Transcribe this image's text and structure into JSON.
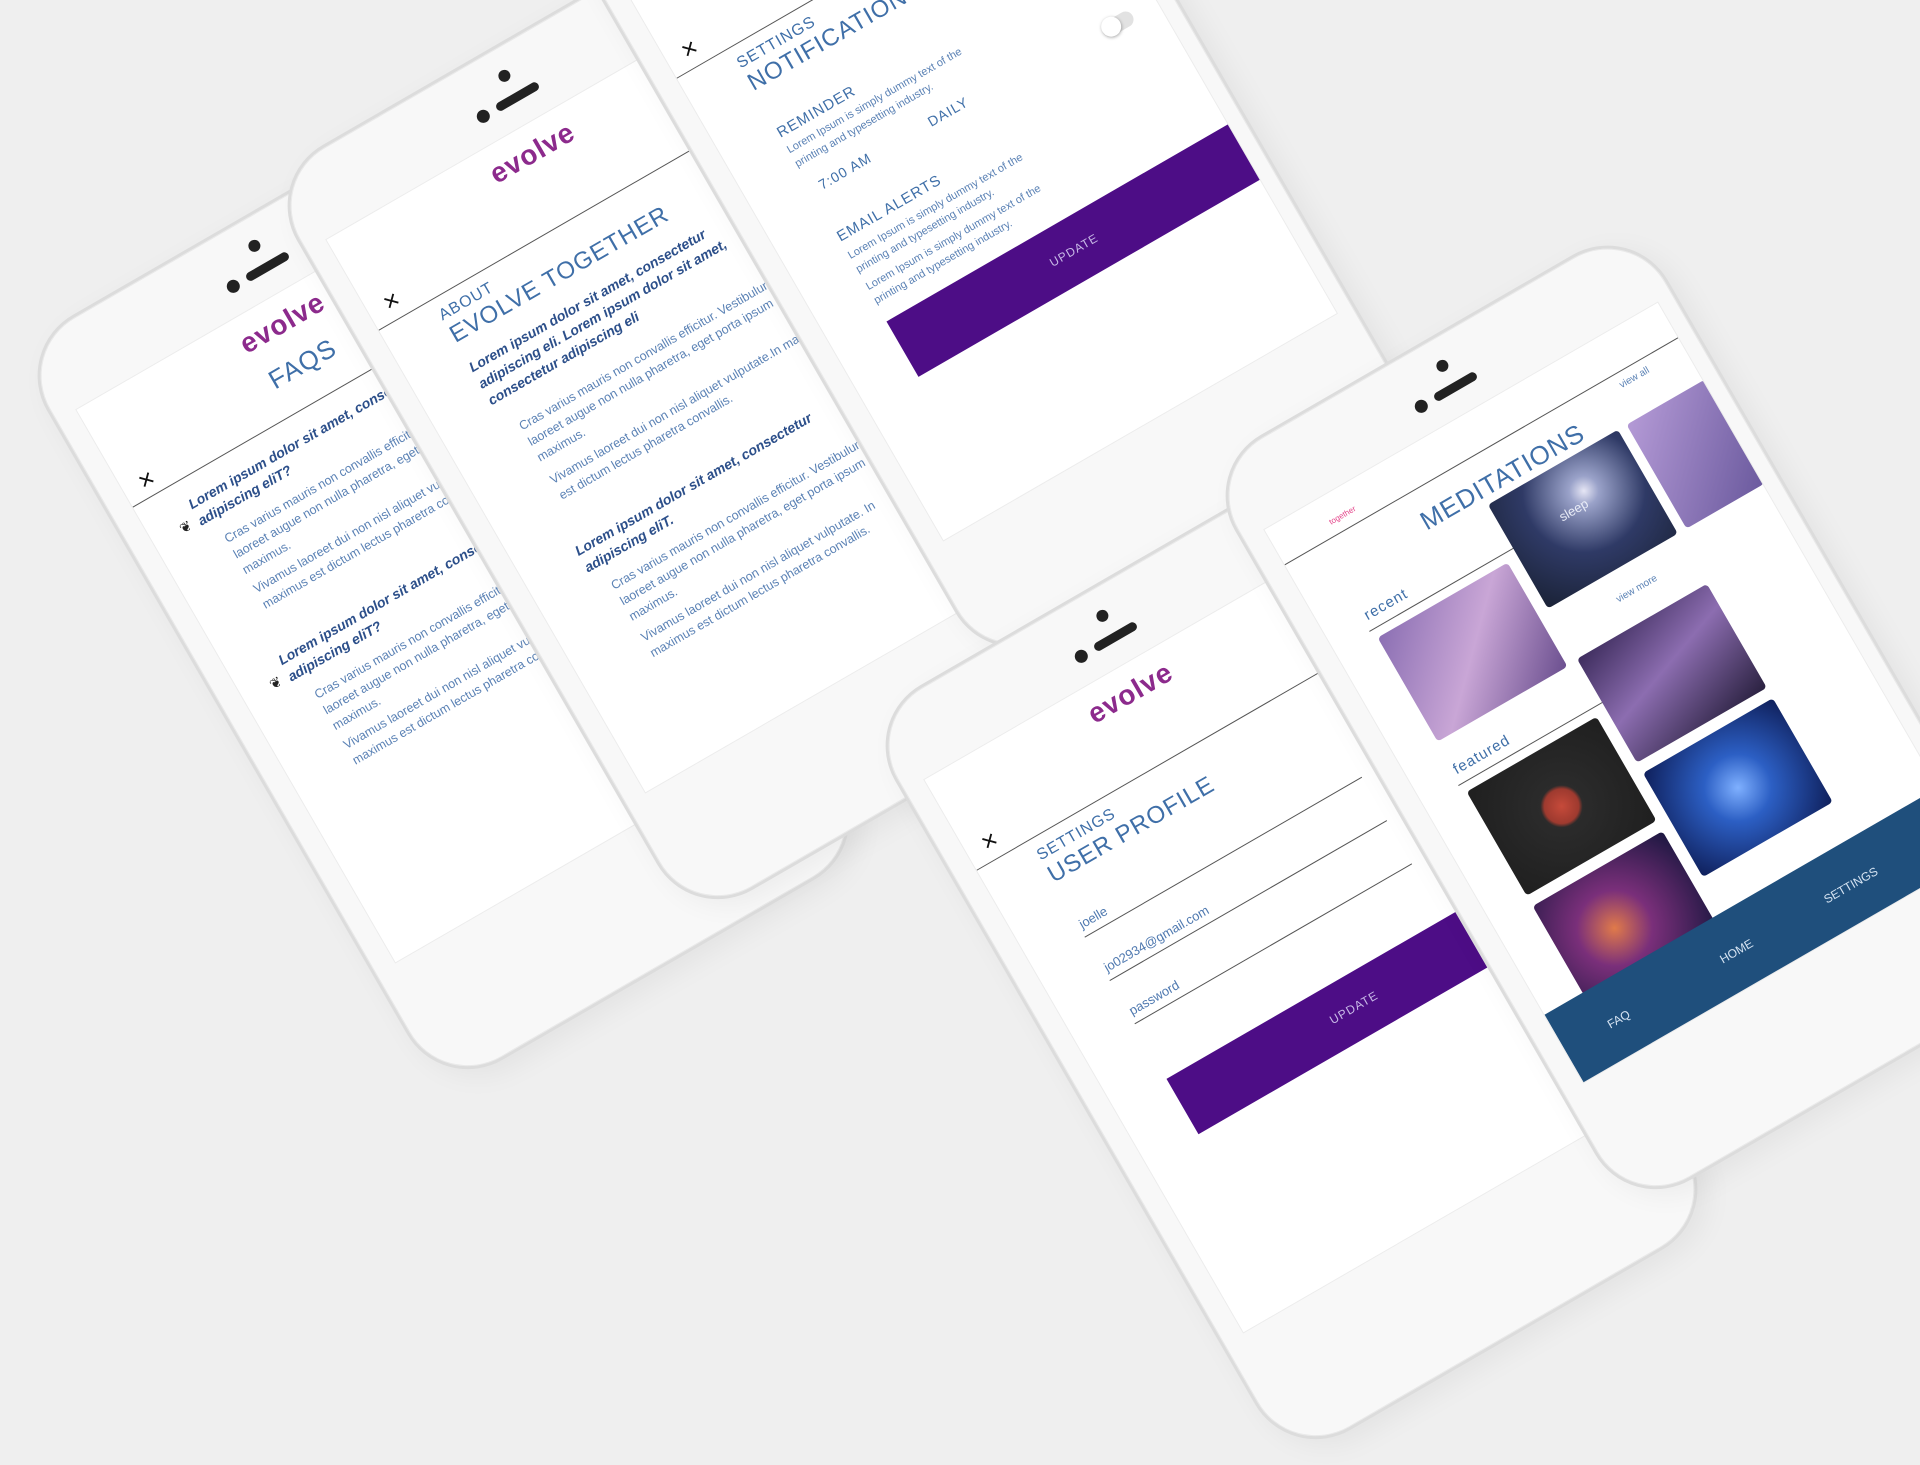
{
  "app": {
    "logo_text": "evolve"
  },
  "faq": {
    "close": "×",
    "title": "FAQS",
    "items": [
      {
        "question": "Lorem ipsum dolor sit amet, consectetur adipiscing eliT?",
        "answer_1": "Cras varius mauris non convallis efficitur. Vestibulum laoreet augue non nulla pharetra, eget porta ipsum maximus.",
        "answer_2": "Vivamus laoreet dui non nisl aliquet vulputate. In maximus est dictum lectus pharetra convallis."
      },
      {
        "question": "Lorem ipsum dolor sit amet, consectetur adipiscing eliT?",
        "answer_1": "Cras varius mauris non convallis efficitur. Vestibulum laoreet augue non nulla pharetra, eget porta ipsum maximus.",
        "answer_2": "Vivamus laoreet dui non nisl aliquet vulputate. In maximus est dictum lectus pharetra convallis."
      }
    ]
  },
  "about": {
    "close": "×",
    "label": "ABOUT",
    "title": "EVOLVE TOGETHER",
    "intro": "Lorem ipsum dolor sit amet, consectetur adipiscing eli. Lorem ipsum dolor sit amet, consectetur adipiscing eli",
    "para_1": "Cras varius mauris non convallis efficitur. Vestibulum laoreet augue non nulla pharetra, eget porta ipsum maximus.",
    "para_2": "Vivamus laoreet dui non nisl aliquet vulputate.In maximus est dictum lectus pharetra convallis.",
    "question": "Lorem ipsum dolor sit amet, consectetur adipiscing eliT.",
    "para_3": "Cras varius mauris non convallis efficitur. Vestibulum laoreet augue non nulla pharetra, eget porta ipsum maximus.",
    "para_4": "Vivamus laoreet dui non nisl aliquet vulputate. In maximus est dictum lectus pharetra convallis."
  },
  "notifications": {
    "close": "×",
    "label": "SETTINGS",
    "title": "NOTIFICATIONS",
    "reminder_label": "REMINDER",
    "reminder_desc": "Lorem Ipsum is simply dummy text of the printing and typesetting industry.",
    "time": "7:00 AM",
    "frequency": "DAILY",
    "email_label": "EMAIL ALERTS",
    "email_desc_1": "Lorem Ipsum is simply dummy text of the printing and typesetting industry.",
    "email_desc_2": "Lorem Ipsum is simply dummy text of the printing and typesetting industry.",
    "update_button": "UPDATE",
    "toggle_master_on": true,
    "toggle_reminder_on": false,
    "toggle_email_on": false
  },
  "profile": {
    "close": "×",
    "label": "SETTINGS",
    "title": "USER PROFILE",
    "name": "joelle",
    "email": "jo02934@gmail.com",
    "password_placeholder": "password",
    "update_button": "UPDATE"
  },
  "meditations": {
    "small_label": "together",
    "title": "MEDITATIONS",
    "view_all": "view all",
    "recent_label": "recent",
    "view_more": "view more",
    "featured_label": "featured",
    "sleep_label": "sleep",
    "nav": [
      "FAQ",
      "HOME",
      "SETTINGS"
    ]
  },
  "colors": {
    "brand_purple": "#4d0d86",
    "logo_magenta": "#8c2a8c",
    "text_blue": "#3f6fa8",
    "nav_blue": "#1f4f7c"
  }
}
